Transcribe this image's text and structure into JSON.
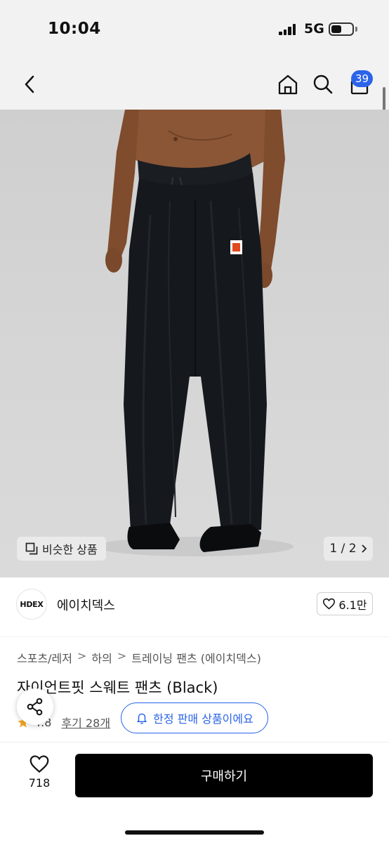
{
  "status_bar": {
    "time": "10:04",
    "network": "5G"
  },
  "nav": {
    "cart_count": "39"
  },
  "hero": {
    "similar_label": "비슷한 상품",
    "pager": "1 / 2"
  },
  "brand": {
    "logo_text": "HDEX",
    "name": "에이치덱스",
    "likes": "6.1만"
  },
  "breadcrumb": [
    "스포츠/레저",
    "하의",
    "트레이닝 팬츠 (에이치덱스)"
  ],
  "product": {
    "title": "자이언트핏 스웨트 팬츠 (Black)",
    "rating": "4.8",
    "reviews": "후기 28개",
    "limited_label": "한정 판매 상품이에요"
  },
  "bottom": {
    "wish_count": "718",
    "buy_label": "구매하기"
  },
  "colors": {
    "accent": "#2b64e8",
    "buy_button": "#000000",
    "star": "#f5a623"
  }
}
